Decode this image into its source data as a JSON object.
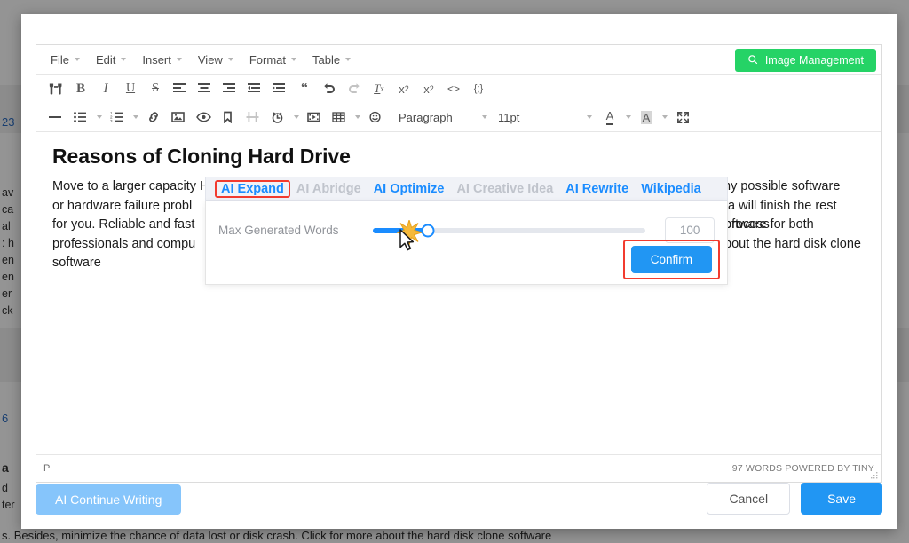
{
  "background_page": {
    "badge_number": "23",
    "second_badge": "6",
    "lines": [
      "av",
      "ca",
      "al",
      ": h",
      "en",
      "en",
      "er",
      "ck"
    ],
    "bold_fragment": "a",
    "tail_lines": [
      "d",
      "ter"
    ],
    "bottom_text": "s. Besides, minimize the chance of data lost or disk crash. Click for more about the hard disk clone software"
  },
  "menubar": {
    "items": [
      {
        "label": "File"
      },
      {
        "label": "Edit"
      },
      {
        "label": "Insert"
      },
      {
        "label": "View"
      },
      {
        "label": "Format"
      },
      {
        "label": "Table"
      }
    ],
    "image_management_label": "Image Management",
    "image_management_icon": "search-icon",
    "image_management_color": "#25d366"
  },
  "toolbar_row1": [
    {
      "name": "find-replace-icon",
      "glyph": "binoculars",
      "dim": false
    },
    {
      "name": "bold-icon",
      "glyph": "B",
      "dim": false
    },
    {
      "name": "italic-icon",
      "glyph": "I",
      "dim": false
    },
    {
      "name": "underline-icon",
      "glyph": "U",
      "dim": false
    },
    {
      "name": "strikethrough-icon",
      "glyph": "S",
      "dim": false
    },
    {
      "name": "align-left-icon",
      "glyph": "align-left",
      "dim": false
    },
    {
      "name": "align-center-icon",
      "glyph": "align-center",
      "dim": false
    },
    {
      "name": "align-right-icon",
      "glyph": "align-right",
      "dim": false
    },
    {
      "name": "outdent-icon",
      "glyph": "outdent",
      "dim": false
    },
    {
      "name": "indent-icon",
      "glyph": "indent",
      "dim": false
    },
    {
      "name": "blockquote-icon",
      "glyph": "quote",
      "dim": false
    },
    {
      "name": "undo-icon",
      "glyph": "undo",
      "dim": false
    },
    {
      "name": "redo-icon",
      "glyph": "redo",
      "dim": true
    },
    {
      "name": "clear-formatting-icon",
      "glyph": "Tx",
      "dim": false
    },
    {
      "name": "subscript-icon",
      "glyph": "x-sub",
      "dim": false
    },
    {
      "name": "superscript-icon",
      "glyph": "x-sup",
      "dim": false
    },
    {
      "name": "source-code-icon",
      "glyph": "<>",
      "dim": false
    },
    {
      "name": "code-sample-icon",
      "glyph": "{;}",
      "dim": false
    }
  ],
  "toolbar_row2": [
    {
      "name": "horizontal-rule-icon",
      "glyph": "hr",
      "dim": false,
      "caret": false
    },
    {
      "name": "bullet-list-icon",
      "glyph": "ul",
      "dim": false,
      "caret": true
    },
    {
      "name": "numbered-list-icon",
      "glyph": "ol",
      "dim": false,
      "caret": true
    },
    {
      "name": "link-icon",
      "glyph": "link",
      "dim": false,
      "caret": false
    },
    {
      "name": "image-icon",
      "glyph": "image",
      "dim": false,
      "caret": false
    },
    {
      "name": "preview-icon",
      "glyph": "eye",
      "dim": false,
      "caret": false
    },
    {
      "name": "anchor-icon",
      "glyph": "bookmark",
      "dim": false,
      "caret": false
    },
    {
      "name": "page-break-icon",
      "glyph": "pagebreak",
      "dim": true,
      "caret": false
    },
    {
      "name": "insert-datetime-icon",
      "glyph": "clock",
      "dim": false,
      "caret": true
    },
    {
      "name": "media-icon",
      "glyph": "media",
      "dim": false,
      "caret": false
    },
    {
      "name": "table-icon",
      "glyph": "table",
      "dim": false,
      "caret": true
    },
    {
      "name": "emoticons-icon",
      "glyph": "smiley",
      "dim": false,
      "caret": false
    }
  ],
  "format_select": {
    "value": "Paragraph"
  },
  "size_select": {
    "value": "11pt"
  },
  "color_tools": {
    "text_color_label": "A",
    "background_color_label": "A",
    "fullscreen_icon": "fullscreen-icon"
  },
  "document": {
    "title": "Reasons of Cloning Hard Drive",
    "body_segments": [
      "Move to a larger capacity HDD and do not want to reinstall system. Replace the old hard drive to a new one. Defend any possible software",
      "or hardware failure probl",
      "ta will finish the rest process",
      "for you. Reliable and fast",
      "oftware for both",
      "professionals and compu",
      "bout the hard disk clone",
      "software"
    ]
  },
  "statusbar": {
    "path": "P",
    "word_count": "97 WORDS POWERED BY TINY"
  },
  "ai_popup": {
    "tabs": [
      {
        "label": "AI Expand",
        "state": "active"
      },
      {
        "label": "AI Abridge",
        "state": "disabled"
      },
      {
        "label": "AI Optimize",
        "state": "enabled"
      },
      {
        "label": "AI Creative Idea",
        "state": "disabled"
      },
      {
        "label": "AI Rewrite",
        "state": "enabled"
      },
      {
        "label": "Wikipedia",
        "state": "enabled"
      }
    ],
    "slider": {
      "label": "Max Generated Words",
      "value": "100",
      "fill_percent": 20,
      "min": 0,
      "max": 500
    },
    "confirm_label": "Confirm",
    "highlight_color": "#f23b2f",
    "accent_color": "#1a8cff"
  },
  "footer": {
    "continue_label": "AI Continue Writing",
    "cancel_label": "Cancel",
    "save_label": "Save"
  }
}
